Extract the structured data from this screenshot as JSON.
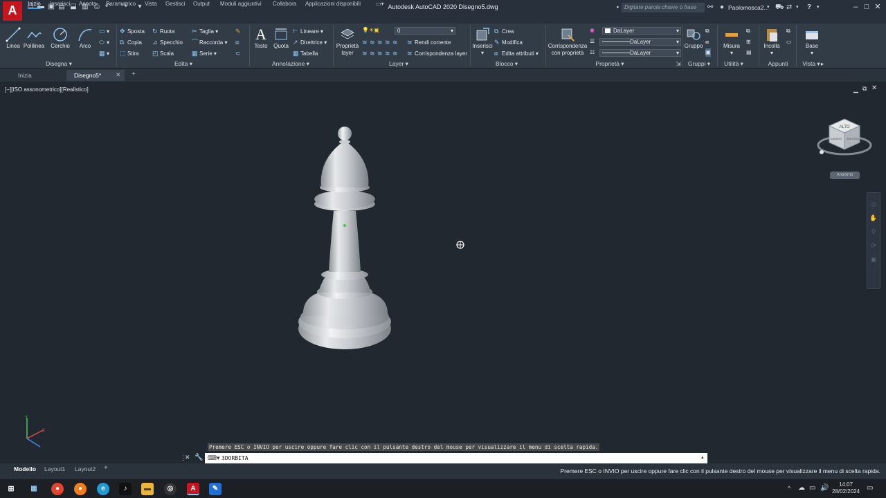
{
  "app": {
    "logo_letter": "A",
    "title": "Autodesk AutoCAD 2020   Disegno5.dwg",
    "search_placeholder": "Digitare parola chiave o frase",
    "user": "Paolomosca2...",
    "help": "?"
  },
  "ribbon_tabs": [
    "Inizio",
    "Inserisci",
    "Annota",
    "Parametrico",
    "Vista",
    "Gestisci",
    "Output",
    "Moduli aggiuntivi",
    "Collabora",
    "Applicazioni disponibili"
  ],
  "ribbon": {
    "disegna": {
      "title": "Disegna",
      "linea": "Linea",
      "polilinea": "Polilinea",
      "cerchio": "Cerchio",
      "arco": "Arco"
    },
    "edita": {
      "title": "Edita",
      "sposta": "Sposta",
      "ruota": "Ruota",
      "taglia": "Taglia",
      "copia": "Copia",
      "specchio": "Specchio",
      "raccorda": "Raccorda",
      "stira": "Stira",
      "scala": "Scala",
      "serie": "Serie"
    },
    "annotazione": {
      "title": "Annotazione",
      "testo": "Testo",
      "quota": "Quota",
      "lineare": "Lineare",
      "direttrice": "Direttrice",
      "tabella": "Tabella"
    },
    "layer": {
      "title": "Layer",
      "proprieta_layer_1": "Proprietà",
      "proprieta_layer_2": "layer",
      "current_layer": "0",
      "rendi_corrente": "Rendi corrente",
      "corrispondenza_layer": "Corrispondenza layer"
    },
    "blocco": {
      "title": "Blocco",
      "inserisci": "Inserisci",
      "crea": "Crea",
      "modifica": "Modifica",
      "edita_attributi": "Edita attributi"
    },
    "proprieta": {
      "title": "Proprietà",
      "corrispondenza_1": "Corrispondenza",
      "corrispondenza_2": "con proprietà",
      "color": "DaLayer",
      "linetype": "DaLayer",
      "lineweight": "DaLayer"
    },
    "gruppi": {
      "title": "Gruppi",
      "gruppo": "Gruppo"
    },
    "utilita": {
      "title": "Utilità",
      "misura": "Misura"
    },
    "appunti": {
      "title": "Appunti",
      "incolla": "Incolla"
    },
    "vista": {
      "title": "Vista",
      "base": "Base"
    }
  },
  "doc_tabs": [
    "Inizia",
    "Disegno5*"
  ],
  "viewport": {
    "label": "[−][ISO assonometrico][Realistico]",
    "viewcube_face": "ALTO",
    "viewcube_front": "DAVANTI",
    "viewcube_side": "SINISTRA",
    "wcs_label": "Anonimo"
  },
  "command": {
    "hint": "Premere ESC o INVIO per uscire oppure fare clic con il pulsante destro del mouse per visualizzare il menu di scelta rapida.",
    "input": "3DORBITA"
  },
  "layout_tabs": [
    "Modello",
    "Layout1",
    "Layout2"
  ],
  "status_text": "Premere ESC o INVIO per uscire oppure fare clic con il pulsante destro del mouse per visualizzare il menu di scelta rapida.",
  "taskbar": {
    "time": "14:07",
    "date": "28/02/2024"
  },
  "colors": {
    "accent": "#3c9fe8",
    "logo": "#c4161c",
    "background": "#212830"
  }
}
